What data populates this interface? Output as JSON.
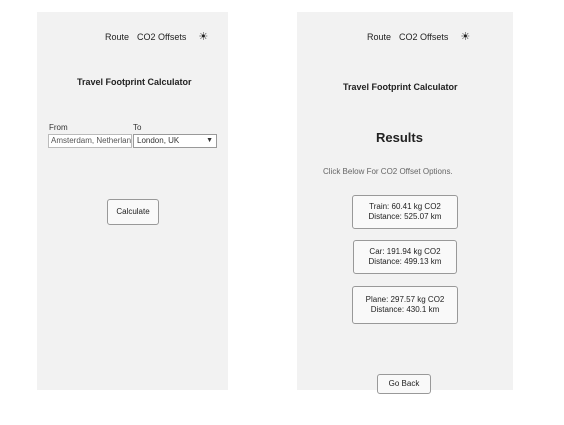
{
  "left": {
    "nav": {
      "route": "Route",
      "offsets": "CO2 Offsets",
      "theme_icon": "sun-icon"
    },
    "title": "Travel Footprint Calculator",
    "from_label": "From",
    "to_label": "To",
    "from_value": "Amsterdam, Netherlands",
    "to_value": "London, UK",
    "calculate": "Calculate"
  },
  "right": {
    "nav": {
      "route": "Route",
      "offsets": "CO2 Offsets",
      "theme_icon": "sun-icon"
    },
    "title": "Travel Footprint Calculator",
    "results_title": "Results",
    "subtitle": "Click Below For CO2 Offset Options.",
    "results": [
      {
        "line1": "Train: 60.41 kg CO2",
        "line2": "Distance: 525.07 km"
      },
      {
        "line1": "Car: 191.94 kg CO2",
        "line2": "Distance: 499.13 km"
      },
      {
        "line1": "Plane: 297.57 kg CO2",
        "line2": "Distance: 430.1 km"
      }
    ],
    "back": "Go Back"
  }
}
